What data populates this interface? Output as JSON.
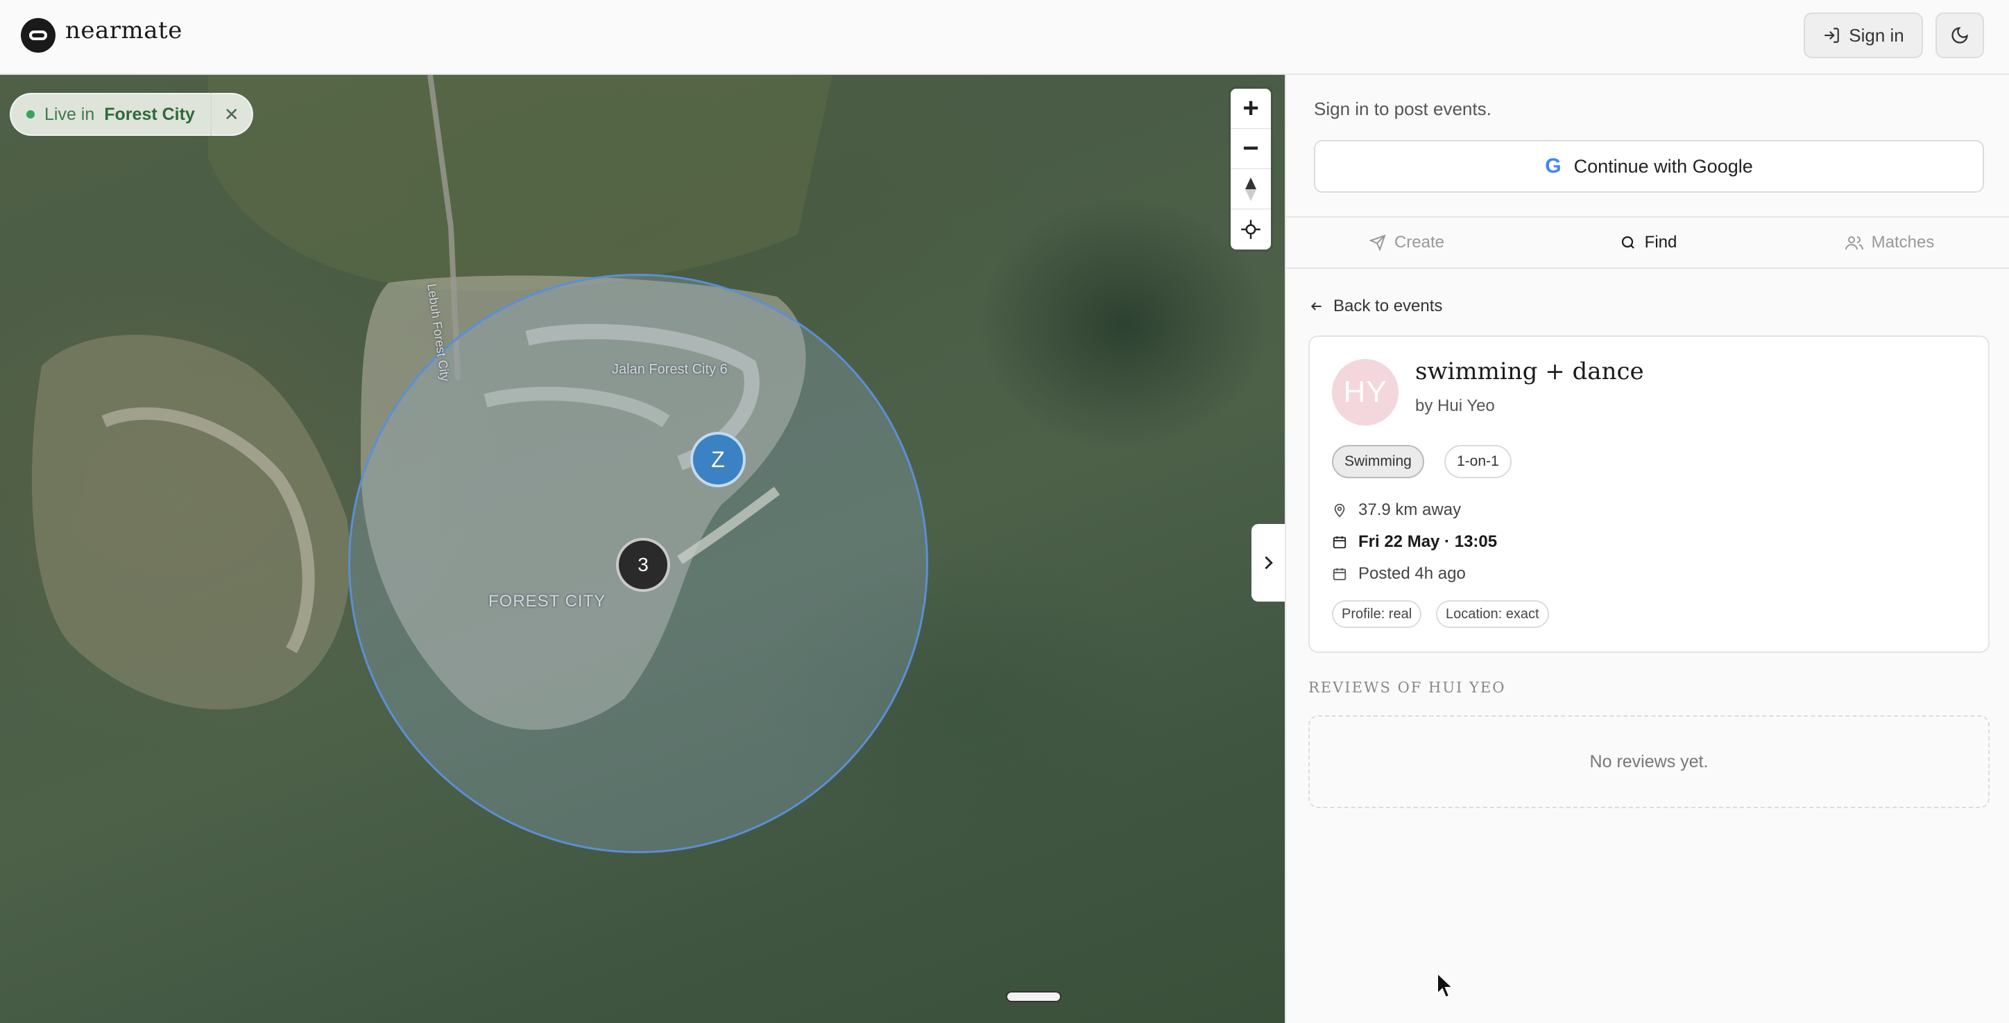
{
  "header": {
    "brand": "nearmate",
    "signin_label": "Sign in"
  },
  "map": {
    "live_label": "Live in",
    "live_city": "Forest City",
    "marker_z_label": "Z",
    "cluster_count": "3",
    "city_label": "FOREST CITY",
    "road_label": "Jalan Forest City 6",
    "road_label_2": "Lebuh Forest City",
    "zoom_in": "+",
    "zoom_out": "−"
  },
  "panel": {
    "signin_prompt": "Sign in to post events.",
    "google_button": "Continue with Google",
    "tabs": [
      {
        "label": "Create"
      },
      {
        "label": "Find"
      },
      {
        "label": "Matches"
      }
    ],
    "back_link": "Back to events",
    "event": {
      "avatar_initials": "HY",
      "title": "swimming + dance",
      "host": "by Hui Yeo",
      "tags": [
        "Swimming",
        "1-on-1"
      ],
      "distance": "37.9 km away",
      "datetime": "Fri 22 May · 13:05",
      "posted": "Posted 4h ago",
      "profile_chip": "Profile: real",
      "location_chip": "Location: exact"
    },
    "reviews_heading": "REVIEWS OF HUI YEO",
    "reviews_empty": "No reviews yet."
  },
  "colors": {
    "accent_blue": "#3b82c4",
    "live_green": "#3aa356",
    "avatar_pink": "#f3d7dc"
  }
}
